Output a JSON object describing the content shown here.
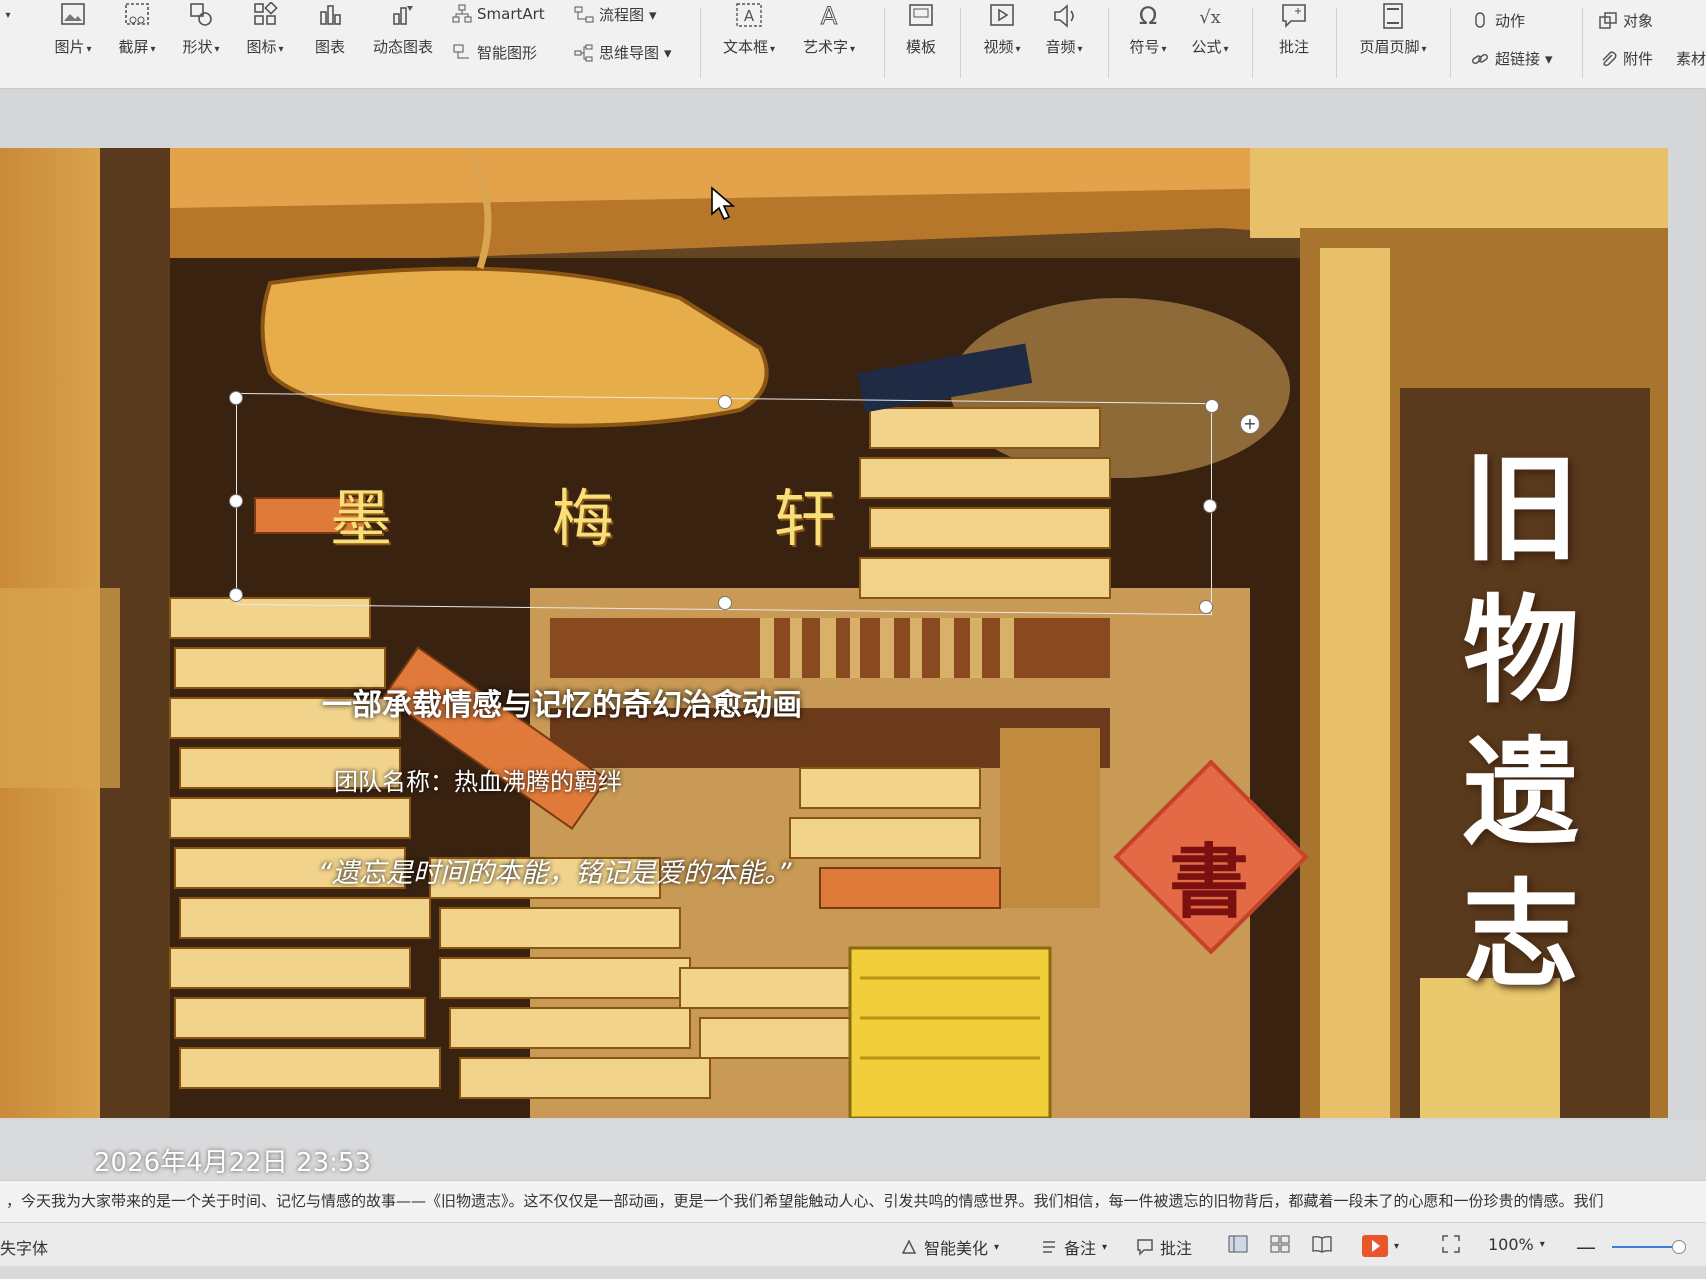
{
  "ribbon": {
    "items": [
      {
        "label": "图片",
        "icon": "picture-icon",
        "caret": true
      },
      {
        "label": "截屏",
        "icon": "scissors-icon",
        "caret": true
      },
      {
        "label": "形状",
        "icon": "shapes-icon",
        "caret": true
      },
      {
        "label": "图标",
        "icon": "icons-icon",
        "caret": true
      },
      {
        "label": "图表",
        "icon": "chart-icon",
        "caret": false
      },
      {
        "label": "动态图表",
        "icon": "dynamic-chart-icon",
        "caret": false
      }
    ],
    "smartart": "SmartArt",
    "flowchart": "流程图",
    "smart_shape": "智能图形",
    "mindmap": "思维导图",
    "textbox": "文本框",
    "wordart": "艺术字",
    "template": "模板",
    "video": "视频",
    "audio": "音频",
    "symbol": "符号",
    "formula": "公式",
    "comment": "批注",
    "header_footer": "页眉页脚",
    "action": "动作",
    "hyperlink": "超链接",
    "object": "对象",
    "attachment": "附件",
    "material": "素材"
  },
  "slide": {
    "sign_text": "墨 梅 轩",
    "subtitle": "一部承载情感与记忆的奇幻治愈动画",
    "team": "团队名称：热血沸腾的羁绊",
    "quote": "“遗忘是时间的本能，铭记是爱的本能。”",
    "title_chars": [
      "旧",
      "物",
      "遗",
      "志"
    ],
    "fu_char": "書"
  },
  "timestamp": "2026年4月22日 23:53",
  "notes": "，今天我为大家带来的是一个关于时间、记忆与情感的故事——《旧物遗志》。这不仅仅是一部动画，更是一个我们希望能触动人心、引发共鸣的情感世界。我们相信，每一件被遗忘的旧物背后，都藏着一段未了的心愿和一份珍贵的情感。我们",
  "status": {
    "font": "失字体",
    "beautify": "智能美化",
    "notes_btn": "备注",
    "comment_btn": "批注",
    "zoom": "100%"
  },
  "colors": {
    "accent": "#e36a45",
    "ribbon_bg": "#f1f1f2",
    "play_button": "#e9552d"
  }
}
